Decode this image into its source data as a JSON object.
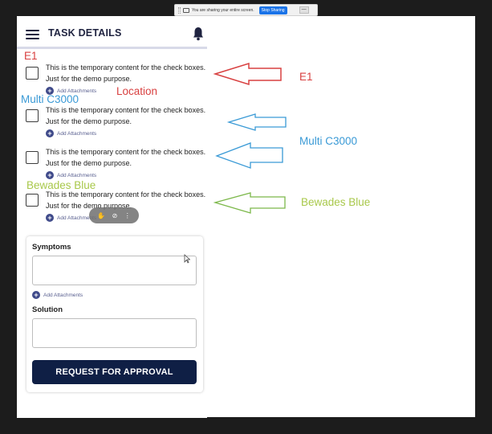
{
  "share_bar": {
    "message": "You are sharing your entire screen.",
    "stop_label": "Stop Sharing",
    "hide_label": "—"
  },
  "app": {
    "title": "TASK DETAILS",
    "items": [
      {
        "text": "This is the temporary content for the check boxes. Just for the demo purpose.",
        "attach_label": "Add Attachments"
      },
      {
        "text": "This is the temporary content for the check boxes. Just for the demo purpose.",
        "attach_label": "Add Attachments"
      },
      {
        "text": "This is the temporary content for the check boxes. Just for the demo purpose.",
        "attach_label": "Add Attachments"
      },
      {
        "text": "This is the temporary content for the check boxes. Just for the demo purpose.",
        "attach_label": "Add Attachments"
      }
    ],
    "symptoms_label": "Symptoms",
    "symptoms_attach_label": "Add Attachments",
    "solution_label": "Solution",
    "approve_label": "REQUEST FOR APPROVAL"
  },
  "annotations": {
    "e1_left": "E1",
    "location": "Location",
    "multi_left": "Multi C3000",
    "bewades_left": "Bewades Blue",
    "e1_right": "E1",
    "multi_right": "Multi C3000",
    "bewades_right": "Bewades Blue"
  },
  "colors": {
    "red": "#d84040",
    "blue": "#3a9ad6",
    "green": "#a8c84a",
    "primary": "#0f1f45"
  }
}
